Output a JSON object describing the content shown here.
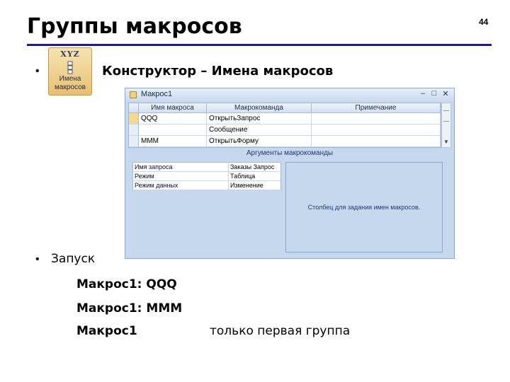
{
  "slide": {
    "title": "Группы макросов",
    "number": "44",
    "bullet": "•"
  },
  "ribbon_button": {
    "icon_text": "XYZ",
    "label_line1": "Имена",
    "label_line2": "макросов"
  },
  "constructor_line": "Конструктор – Имена макросов",
  "access_window": {
    "title": "Макрос1",
    "buttons": {
      "minimize": "–",
      "maximize": "□",
      "close": "✕"
    },
    "columns": [
      "Имя макроса",
      "Макрокоманда",
      "Примечание"
    ],
    "rows": [
      {
        "name": "QQQ",
        "action": "ОткрытьЗапрос",
        "note": ""
      },
      {
        "name": "",
        "action": "Сообщение",
        "note": ""
      },
      {
        "name": "MMM",
        "action": "ОткрытьФорму",
        "note": ""
      }
    ],
    "args_title": "Аргументы макрокоманды",
    "args": [
      {
        "name": "Имя запроса",
        "value": "Заказы Запрос"
      },
      {
        "name": "Режим",
        "value": "Таблица"
      },
      {
        "name": "Режим данных",
        "value": "Изменение"
      }
    ],
    "args_description": "Столбец для задания имен макросов."
  },
  "run": {
    "label": "Запуск",
    "lines": [
      "Макрос1: QQQ",
      "Макрос1: MMM",
      "Макрос1"
    ],
    "note": "только первая группа"
  }
}
